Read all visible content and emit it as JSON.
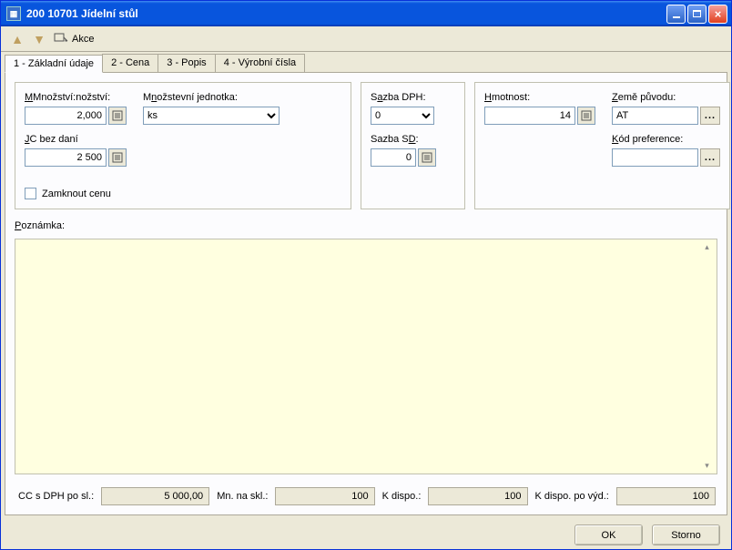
{
  "window": {
    "title": "200 10701 Jídelní stůl"
  },
  "toolbar": {
    "akce_label": "Akce"
  },
  "tabs": {
    "t1": "1 - Základní údaje",
    "t2": "2 - Cena",
    "t3": "3 - Popis",
    "t4": "4 - Výrobní čísla"
  },
  "fields": {
    "mnozstvi": {
      "label": "Množství:",
      "value": "2,000"
    },
    "mj": {
      "label": "Množstevní jednotka:",
      "value": "ks"
    },
    "jc": {
      "label": "JC bez daní",
      "value": "2 500"
    },
    "zamknout": {
      "label": "Zamknout cenu"
    },
    "sazba_dph": {
      "label": "Sazba DPH:",
      "value": "0"
    },
    "sazba_sd": {
      "label": "Sazba SD:",
      "value": "0"
    },
    "hmotnost": {
      "label": "Hmotnost:",
      "value": "14"
    },
    "zeme": {
      "label": "Země původu:",
      "value": "AT"
    },
    "kod_pref": {
      "label": "Kód preference:",
      "value": ""
    },
    "poznamka": {
      "label": "Poznámka:"
    }
  },
  "bottom": {
    "cc_label": "CC s DPH po sl.:",
    "cc_value": "5 000,00",
    "mn_label": "Mn. na skl.:",
    "mn_value": "100",
    "kd_label": "K dispo.:",
    "kd_value": "100",
    "kdv_label": "K dispo. po výd.:",
    "kdv_value": "100"
  },
  "buttons": {
    "ok": "OK",
    "storno": "Storno"
  }
}
